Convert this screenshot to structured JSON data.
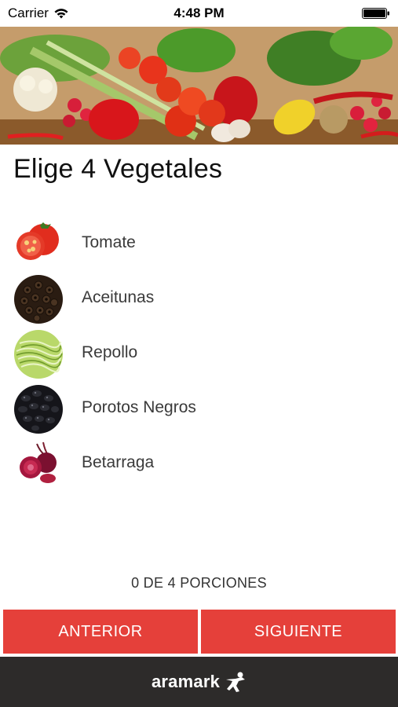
{
  "status_bar": {
    "carrier": "Carrier",
    "time": "4:48 PM",
    "icons": [
      "wifi-icon",
      "battery-icon"
    ]
  },
  "header": {
    "title": "Elige 4 Vegetales",
    "banner": "vegetables-banner"
  },
  "vegetables": [
    {
      "label": "Tomate",
      "icon": "tomato-icon"
    },
    {
      "label": "Aceitunas",
      "icon": "olives-icon"
    },
    {
      "label": "Repollo",
      "icon": "cabbage-icon"
    },
    {
      "label": "Porotos Negros",
      "icon": "black-beans-icon"
    },
    {
      "label": "Betarraga",
      "icon": "beet-icon"
    }
  ],
  "portions": {
    "text": "0 DE 4 PORCIONES",
    "selected": 0,
    "total": 4
  },
  "buttons": {
    "previous": "ANTERIOR",
    "next": "SIGUIENTE"
  },
  "footer": {
    "brand": "aramark"
  },
  "colors": {
    "accent": "#e5403a",
    "footer_bg": "#2d2b2a",
    "text": "#3a3a3a"
  }
}
